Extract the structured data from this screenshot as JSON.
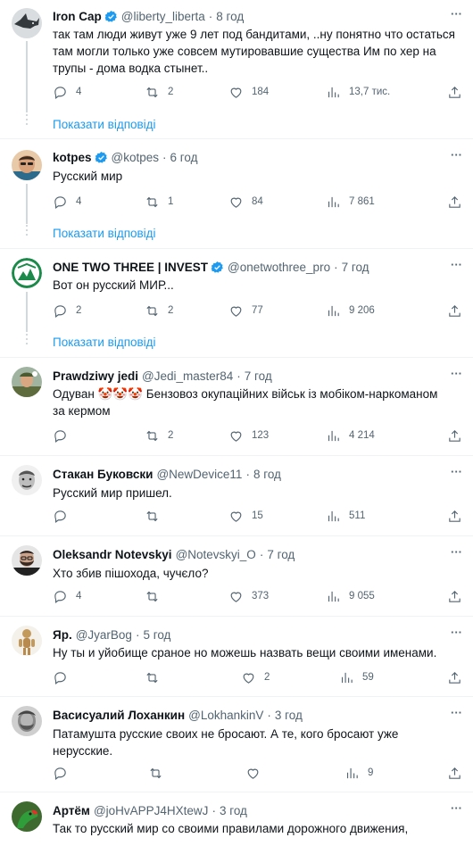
{
  "accent": "#1d9bf0",
  "show_replies_label": "Показати відповіді",
  "tweets": [
    {
      "name": "Iron Cap",
      "verified": true,
      "handle": "@liberty_liberta",
      "time": "8 год",
      "text": "так там люди живут уже 9 лет под бандитами, ..ну понятно что остаться\nтам могли только уже совсем мутировавшие существа Им по хер на\nтрупы - дома водка стынет..",
      "replies": "4",
      "retweets": "2",
      "likes": "184",
      "views": "13,7 тис.",
      "avatar_icon": "shark-avatar-icon"
    },
    {
      "name": "kotpes",
      "verified": true,
      "handle": "@kotpes",
      "time": "6 год",
      "text": "Русский мир",
      "replies": "4",
      "retweets": "1",
      "likes": "84",
      "views": "7 861",
      "avatar_icon": "man-portrait-avatar-icon"
    },
    {
      "name": "ONE TWO THREE | INVEST",
      "verified": true,
      "handle": "@onetwothree_pro",
      "time": "7 год",
      "text": "Вот он русский МИР...",
      "replies": "2",
      "retweets": "2",
      "likes": "77",
      "views": "9 206",
      "avatar_icon": "invest-logo-avatar-icon"
    },
    {
      "name": "Prawdziwy jedi",
      "verified": false,
      "handle": "@Jedi_master84",
      "time": "7 год",
      "text": "Одуван 🤡🤡🤡 Бензовоз окупаційних військ із мобіком-наркоманом\nза кермом",
      "replies": "",
      "retweets": "2",
      "likes": "123",
      "views": "4 214",
      "avatar_icon": "soldier-avatar-icon"
    },
    {
      "name": "Стакан Буковски",
      "verified": false,
      "handle": "@NewDevice11",
      "time": "8 год",
      "text": "Русский мир пришел.",
      "replies": "",
      "retweets": "",
      "likes": "15",
      "views": "511",
      "avatar_icon": "bukowski-avatar-icon"
    },
    {
      "name": "Oleksandr Notevskyi",
      "verified": false,
      "handle": "@Notevskyi_O",
      "time": "7 год",
      "text": "Хто збив пішохода, чучєло?",
      "replies": "4",
      "retweets": "",
      "likes": "373",
      "views": "9 055",
      "avatar_icon": "bearded-man-avatar-icon"
    },
    {
      "name": "Яр.",
      "verified": false,
      "handle": "@JyarBog",
      "time": "5 год",
      "text": "Ну ты и уйобище сраное  но можешь назвать вещи своими именами.",
      "replies": "",
      "retweets": "",
      "likes": "2",
      "views": "59",
      "avatar_icon": "wooden-mannequin-avatar-icon"
    },
    {
      "name": "Васисуалий Лоханкин",
      "verified": false,
      "handle": "@LokhankinV",
      "time": "3 год",
      "text": "Патамушта русские своих не бросают. А те, кого бросают уже\nнерусские.",
      "replies": "",
      "retweets": "",
      "likes": "",
      "views": "9",
      "avatar_icon": "old-man-avatar-icon"
    },
    {
      "name": "Артём",
      "verified": false,
      "handle": "@joHvAPPJ4HXtewJ",
      "time": "3 год",
      "text": "Так то русский мир со своими правилами дорожного движения,",
      "replies": "",
      "retweets": "",
      "likes": "",
      "views": "",
      "avatar_icon": "parrot-avatar-icon"
    }
  ]
}
